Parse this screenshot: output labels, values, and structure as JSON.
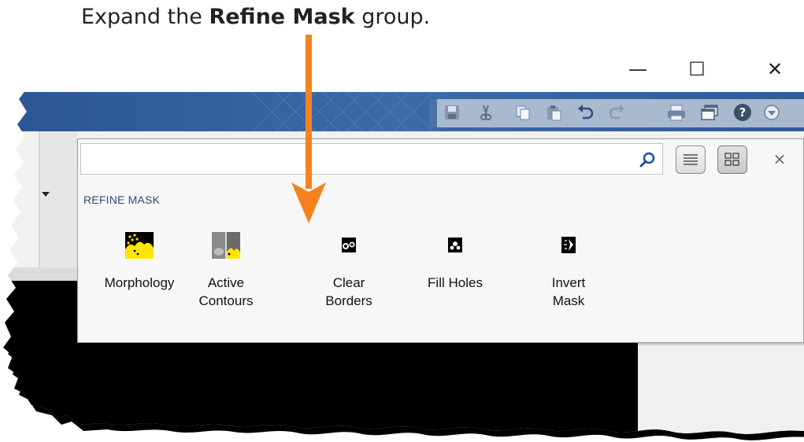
{
  "caption": {
    "prefix": "Expand the ",
    "bold": "Refine Mask",
    "suffix": " group."
  },
  "window": {
    "minimize": "—",
    "maximize": "☐",
    "close": "✕"
  },
  "quick_access": [
    "save-icon",
    "cut-icon",
    "copy-icon",
    "paste-icon",
    "undo-icon",
    "redo-icon",
    "print-icon",
    "windows-icon",
    "help-icon",
    "menu-icon"
  ],
  "popup": {
    "search_value": "",
    "search_placeholder": "",
    "close": "×",
    "group_title": "REFINE MASK",
    "tools": [
      {
        "label": "Morphology",
        "icon": "morphology-icon"
      },
      {
        "label": "Active\nContours",
        "icon": "active-contours-icon"
      },
      {
        "label": "Clear\nBorders",
        "icon": "clear-borders-icon"
      },
      {
        "label": "Fill Holes",
        "icon": "fill-holes-icon"
      },
      {
        "label": "Invert\nMask",
        "icon": "invert-mask-icon"
      }
    ]
  },
  "colors": {
    "ribbon": "#2f5f9c",
    "arrow": "#f5821f",
    "popup_bg": "#f7f7f7",
    "group_title": "#2c4a7a"
  }
}
